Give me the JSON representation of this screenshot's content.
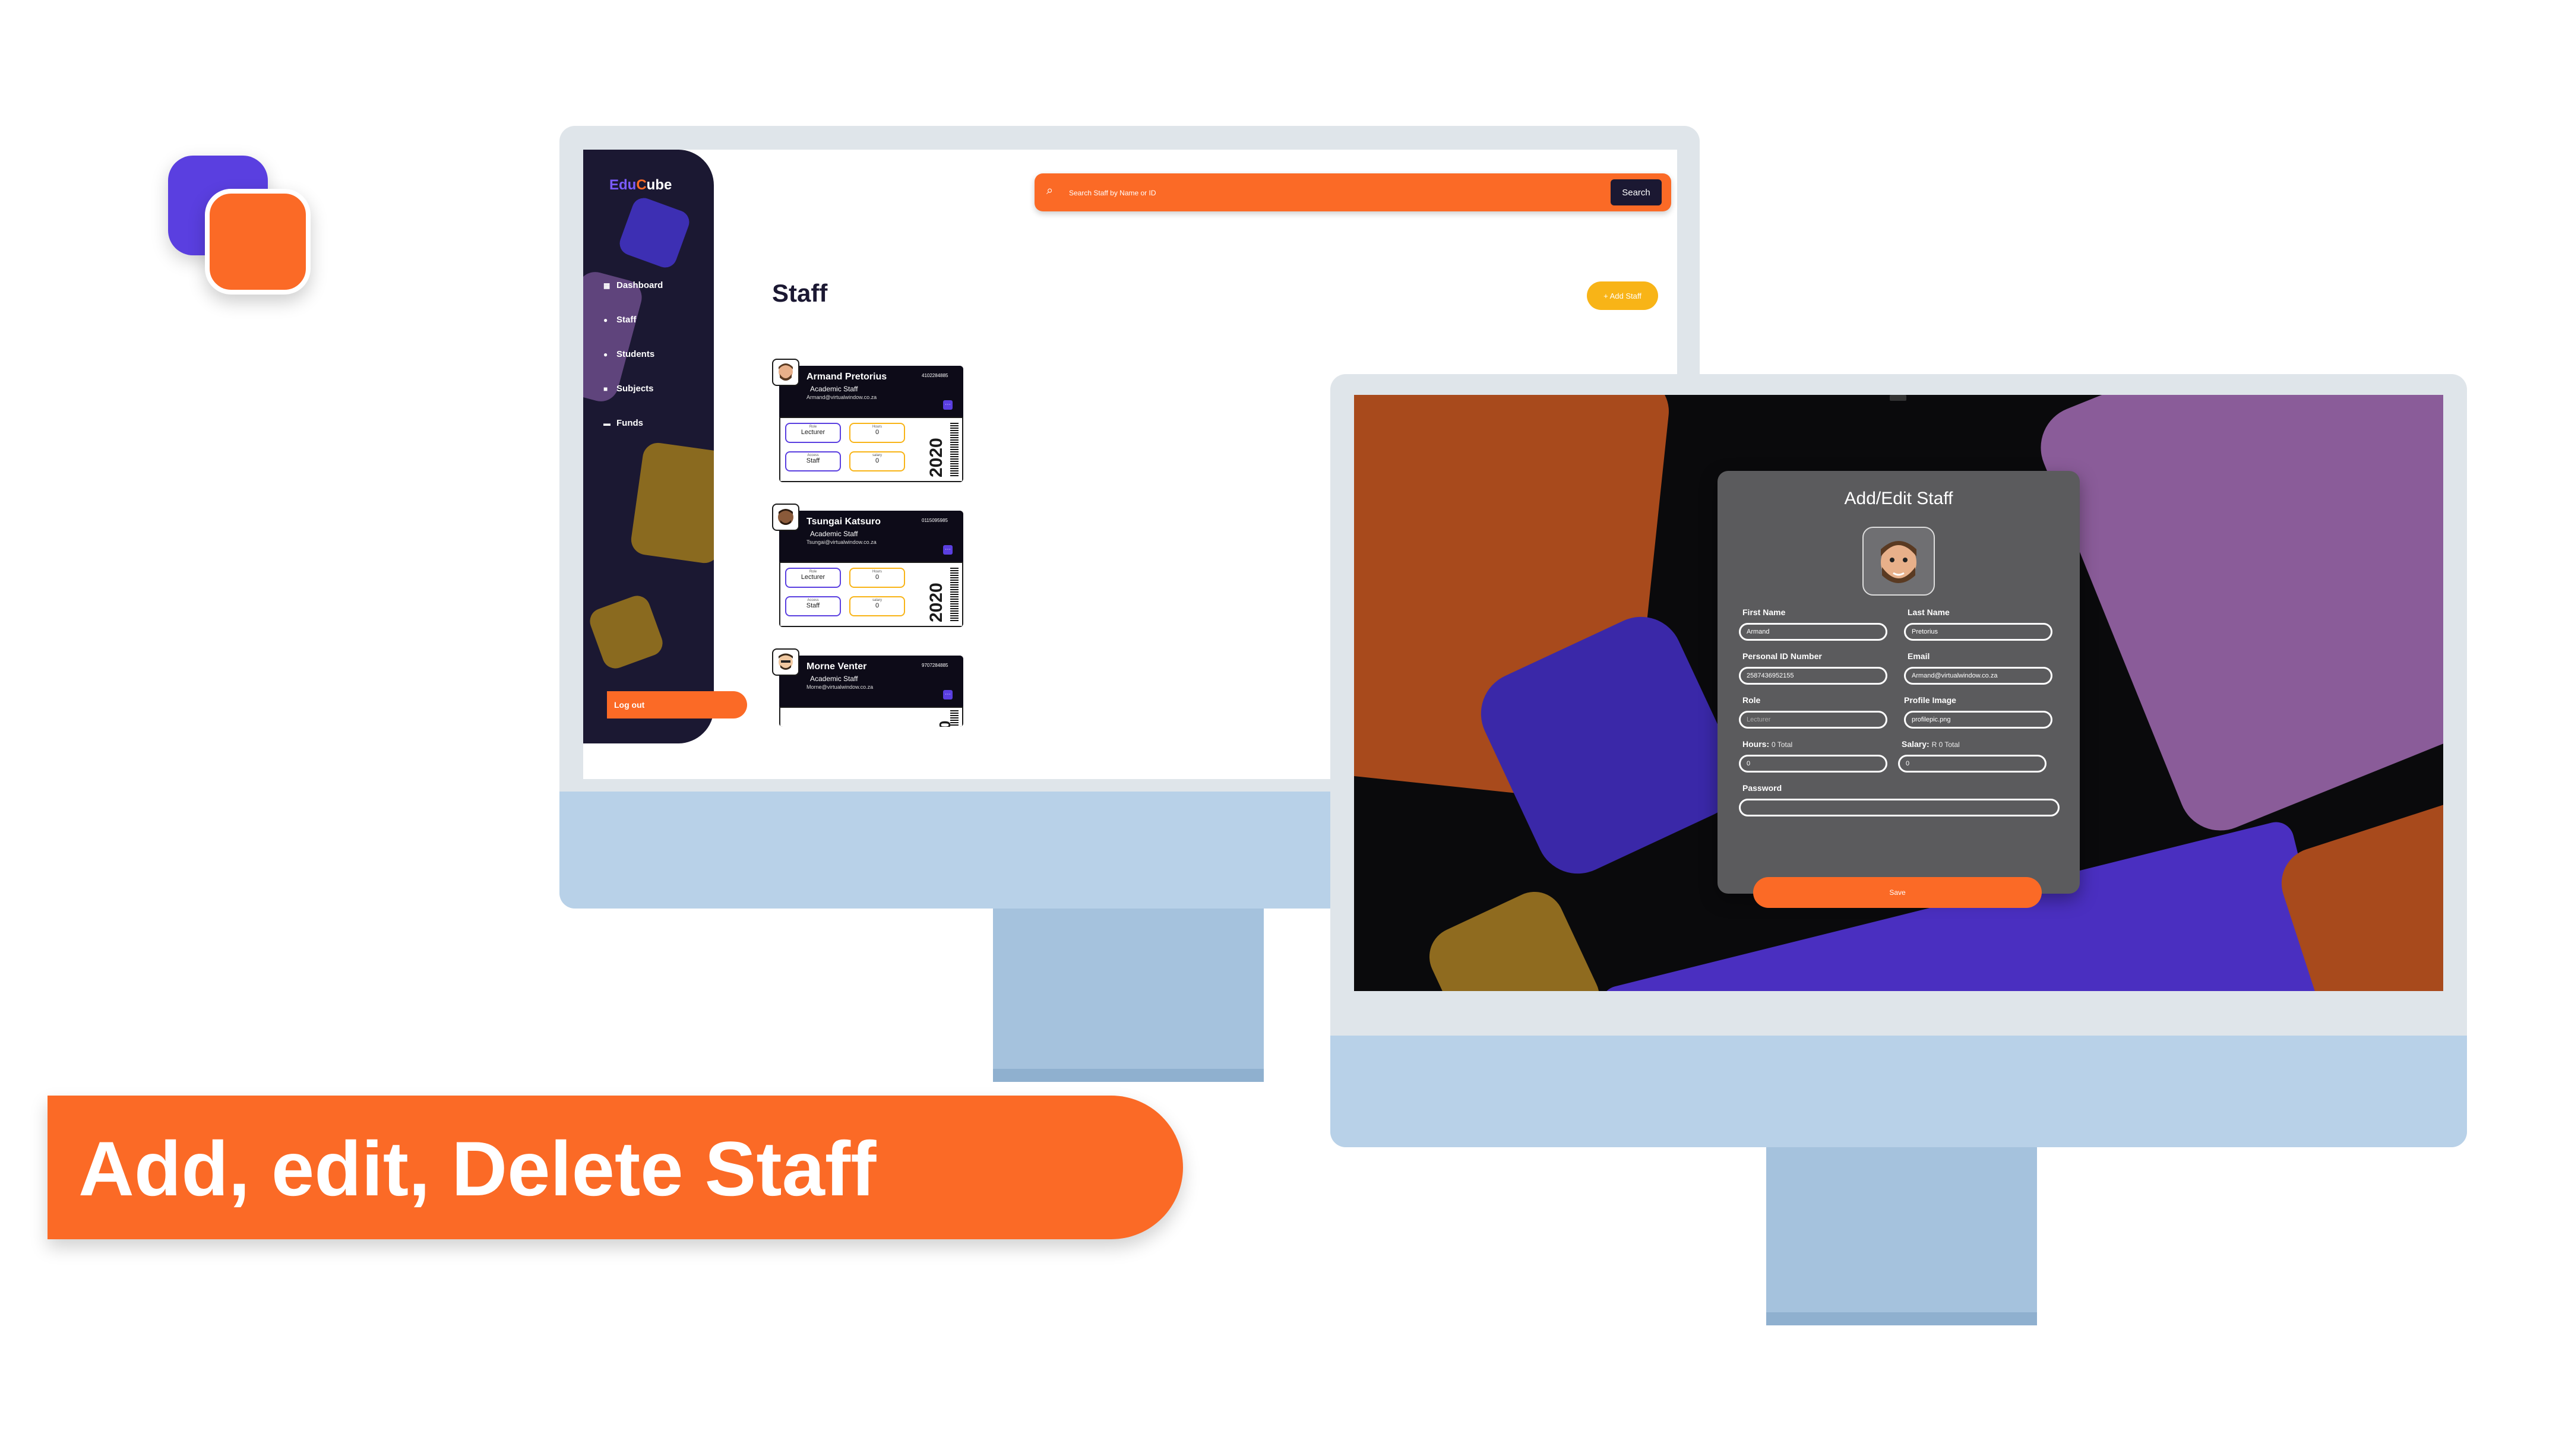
{
  "banner": {
    "text": "Add, edit, Delete Staff"
  },
  "colors": {
    "accent": "#fb6a26",
    "brand_purple": "#5a3fe0",
    "sidebar": "#1b1832",
    "add_button": "#f8b417"
  },
  "app": {
    "brand_prefix": "Edu",
    "brand_c": "C",
    "brand_suffix": "ube",
    "nav": [
      {
        "label": "Dashboard",
        "icon": "dashboard-icon"
      },
      {
        "label": "Staff",
        "icon": "person-icon"
      },
      {
        "label": "Students",
        "icon": "people-icon"
      },
      {
        "label": "Subjects",
        "icon": "book-icon"
      },
      {
        "label": "Funds",
        "icon": "wallet-icon"
      }
    ],
    "logout": "Log out",
    "search": {
      "placeholder": "Search Staff by Name or ID",
      "button": "Search"
    },
    "page_title": "Staff",
    "add_staff": "+ Add Staff",
    "cards": [
      {
        "name": "Armand Pretorius",
        "role": "Academic Staff",
        "email": "Armand@virtualwindow.co.za",
        "id": "4102284885",
        "pill1_label": "Role",
        "pill1_value": "Lecturer",
        "pill2_label": "Hours",
        "pill2_value": "0",
        "pill3_label": "Access",
        "pill3_value": "Staff",
        "pill4_label": "salary",
        "pill4_value": "0",
        "year": "2020"
      },
      {
        "name": "Tsungai Katsuro",
        "role": "Academic Staff",
        "email": "Tsungai@virtualwindow.co.za",
        "id": "0115095985",
        "pill1_label": "Role",
        "pill1_value": "Lecturer",
        "pill2_label": "Hours",
        "pill2_value": "0",
        "pill3_label": "Access",
        "pill3_value": "Staff",
        "pill4_label": "salary",
        "pill4_value": "0",
        "year": "2020"
      },
      {
        "name": "Morne Venter",
        "role": "Academic Staff",
        "email": "Morne@virtualwindow.co.za",
        "id": "9707284885",
        "year": "0"
      }
    ]
  },
  "modal": {
    "title": "Add/Edit Staff",
    "first_name_label": "First Name",
    "first_name_value": "Armand",
    "last_name_label": "Last Name",
    "last_name_value": "Pretorius",
    "id_label": "Personal ID Number",
    "id_value": "2587436952155",
    "email_label": "Email",
    "email_value": "Armand@virtualwindow.co.za",
    "role_label": "Role",
    "role_placeholder": "Lecturer",
    "image_label": "Profile Image",
    "image_value": "profilepic.png",
    "hours_label": "Hours:",
    "hours_hint": "0 Total",
    "hours_value": "0",
    "salary_label": "Salary:",
    "salary_hint": "R 0 Total",
    "salary_value": "0",
    "password_label": "Password",
    "save": "Save"
  }
}
